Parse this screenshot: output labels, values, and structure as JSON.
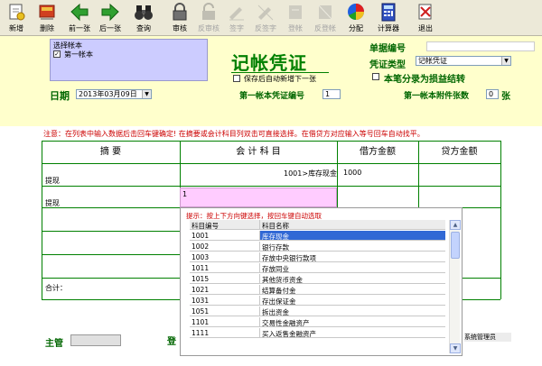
{
  "toolbar": {
    "buttons": [
      {
        "label": "新增",
        "icon": "new-doc-icon",
        "enabled": true
      },
      {
        "label": "删除",
        "icon": "delete-icon",
        "enabled": true
      },
      {
        "label": "前一张",
        "icon": "prev-arrow-icon",
        "enabled": true
      },
      {
        "label": "后一张",
        "icon": "next-arrow-icon",
        "enabled": true
      },
      {
        "label": "查询",
        "icon": "binoculars-icon",
        "enabled": true
      },
      {
        "label": "审核",
        "icon": "lock-icon",
        "enabled": true
      },
      {
        "label": "反审核",
        "icon": "unlock-icon",
        "enabled": false
      },
      {
        "label": "签字",
        "icon": "sign-icon",
        "enabled": false
      },
      {
        "label": "反签字",
        "icon": "unsign-icon",
        "enabled": false
      },
      {
        "label": "登帐",
        "icon": "post-icon",
        "enabled": false
      },
      {
        "label": "反登帐",
        "icon": "unpost-icon",
        "enabled": false
      },
      {
        "label": "分配",
        "icon": "pie-chart-icon",
        "enabled": true
      },
      {
        "label": "计算器",
        "icon": "calculator-icon",
        "enabled": true
      },
      {
        "label": "退出",
        "icon": "exit-icon",
        "enabled": true
      }
    ]
  },
  "account_panel": {
    "title": "选择帐本",
    "item_label": "第一帐本",
    "item_checked": true
  },
  "voucher": {
    "title": "记帐凭证",
    "save_new_label": "保存后自动新增下一张",
    "doc_no_label": "单据编号",
    "doc_no_value": "",
    "type_label": "凭证类型",
    "type_value": "记帐凭证",
    "profit_loss_label": "本笔分录为损益结转",
    "date_label": "日期",
    "date_value": "2013年03月09日",
    "number_label": "第一帐本凭证编号",
    "number_value": "1",
    "attach_label": "第一帐本附件张数",
    "attach_value": "0",
    "attach_unit": "张"
  },
  "notice": "注意：在列表中输入数据后击回车键确定! 在摘要或会计科目列双击可直接选择。在借贷方对应输入等号回车自动找平。",
  "table": {
    "headers": [
      "摘   要",
      "会 计 科 目",
      "借方金额",
      "贷方金额"
    ],
    "rows": [
      {
        "summary": "提现",
        "account": "1001>库存现金",
        "debit": "1000",
        "credit": ""
      },
      {
        "summary": "提现",
        "account": "1",
        "debit": "",
        "credit": ""
      }
    ],
    "total_label": "合计："
  },
  "popup": {
    "tip": "提示：按上下方向键选择，按回车键自动选取",
    "col_code": "科目编号",
    "col_name": "科目名称",
    "items": [
      {
        "code": "1001",
        "name": "库存现金"
      },
      {
        "code": "1002",
        "name": "银行存款"
      },
      {
        "code": "1003",
        "name": "存放中央银行款项"
      },
      {
        "code": "1011",
        "name": "存放同业"
      },
      {
        "code": "1015",
        "name": "其他货币资金"
      },
      {
        "code": "1021",
        "name": "结算备付金"
      },
      {
        "code": "1031",
        "name": "存出保证金"
      },
      {
        "code": "1051",
        "name": "拆出资金"
      },
      {
        "code": "1101",
        "name": "交易性金融资产"
      },
      {
        "code": "1111",
        "name": "买入返售金融资产"
      }
    ],
    "selected_index": 0
  },
  "footer": {
    "supervisor_label": "主管",
    "entry_label": "登",
    "user": "系统管理员"
  },
  "colors": {
    "accent_green": "#008000",
    "notice_red": "#cc0000",
    "header_bg": "#ffffcc",
    "panel_purple": "#ccccff",
    "selection_blue": "#3168d5"
  }
}
